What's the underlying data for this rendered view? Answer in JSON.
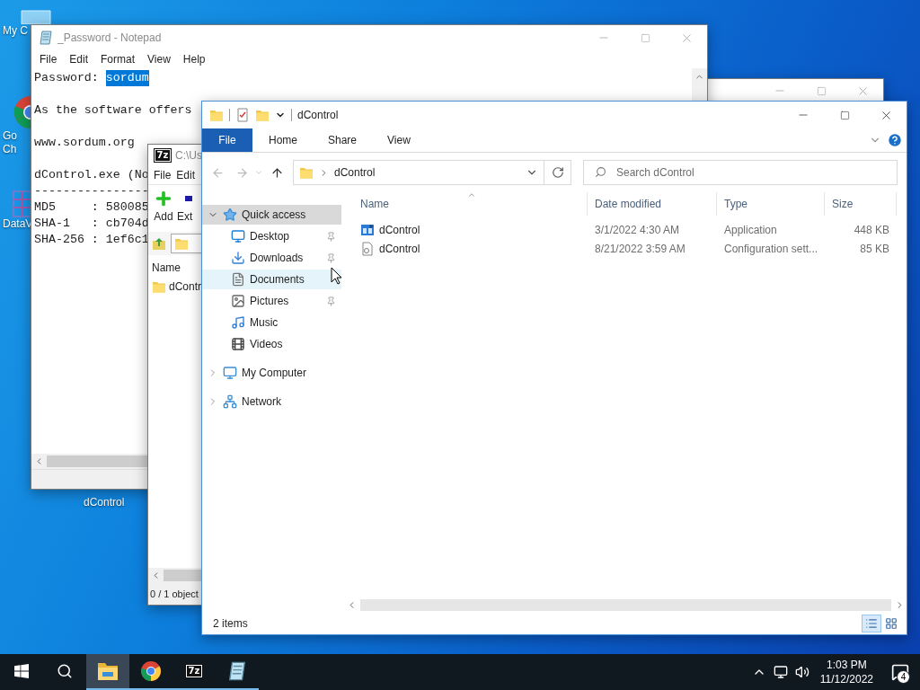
{
  "desktop": {
    "icons": [
      {
        "kind": "computer",
        "label_lines": [
          "My C"
        ]
      },
      {
        "kind": "chrome",
        "label_lines": [
          "Go",
          "Ch"
        ]
      },
      {
        "kind": "dataview",
        "label_lines": [
          "DataV"
        ]
      },
      {
        "kind": "app",
        "label_lines": [
          "dControl"
        ]
      }
    ]
  },
  "notepad": {
    "title": "_Password - Notepad",
    "menu": [
      "File",
      "Edit",
      "Format",
      "View",
      "Help"
    ],
    "paragraphs": [
      [
        {
          "text": "Password: ",
          "highlight": "sordum"
        }
      ],
      [
        {
          "text": "As the software offers"
        }
      ],
      [
        {
          "text": "www.sordum.org"
        }
      ],
      [
        {
          "text": "dControl.exe (No"
        },
        {
          "text": "----------------"
        },
        {
          "text": "MD5     : 580085"
        },
        {
          "text": "SHA-1   : cb704d"
        },
        {
          "text": "SHA-256 : 1ef6c1"
        }
      ]
    ]
  },
  "archiver": {
    "title": "C:\\Us",
    "icon_text": "7z",
    "menu": [
      "File",
      "Edit"
    ],
    "toolbar": [
      {
        "kind": "add",
        "label": "Add"
      },
      {
        "kind": "extract",
        "label": "Ext"
      }
    ],
    "column": "Name",
    "rows": [
      "dContr"
    ],
    "status": "0 / 1 object"
  },
  "explorer": {
    "title": "dControl",
    "tabs": [
      {
        "label": "File",
        "selected": true
      },
      {
        "label": "Home",
        "selected": false
      },
      {
        "label": "Share",
        "selected": false
      },
      {
        "label": "View",
        "selected": false
      }
    ],
    "address": "dControl",
    "search": {
      "placeholder": "Search dControl"
    },
    "nav": [
      {
        "label": "Quick access",
        "kind": "star",
        "expanded": true,
        "selected": true,
        "hovered": false,
        "children": [
          {
            "label": "Desktop",
            "kind": "desktop",
            "pinned": true,
            "selected": false,
            "hovered": false
          },
          {
            "label": "Downloads",
            "kind": "downloads",
            "pinned": true,
            "selected": false,
            "hovered": false
          },
          {
            "label": "Documents",
            "kind": "documents",
            "pinned": false,
            "selected": false,
            "hovered": true
          },
          {
            "label": "Pictures",
            "kind": "pictures",
            "pinned": true,
            "selected": false,
            "hovered": false
          },
          {
            "label": "Music",
            "kind": "music",
            "pinned": false,
            "selected": false,
            "hovered": false
          },
          {
            "label": "Videos",
            "kind": "videos",
            "pinned": false,
            "selected": false,
            "hovered": false
          }
        ]
      },
      {
        "label": "My Computer",
        "kind": "computer",
        "expanded": false,
        "selected": false,
        "hovered": false
      },
      {
        "label": "Network",
        "kind": "network",
        "expanded": false,
        "selected": false,
        "hovered": false
      }
    ],
    "columns": [
      "Name",
      "Date modified",
      "Type",
      "Size"
    ],
    "files": [
      {
        "kind": "application",
        "name": "dControl",
        "date": "3/1/2022 4:30 AM",
        "type": "Application",
        "size": "448 KB"
      },
      {
        "kind": "config",
        "name": "dControl",
        "date": "8/21/2022 3:59 AM",
        "type": "Configuration sett...",
        "size": "85 KB"
      }
    ],
    "status": "2 items",
    "views": [
      {
        "kind": "details",
        "selected": true
      },
      {
        "kind": "large_icons",
        "selected": false
      }
    ]
  },
  "taskbar": {
    "buttons": [
      {
        "kind": "start",
        "running": false,
        "active": false
      },
      {
        "kind": "search",
        "running": false,
        "active": false
      },
      {
        "kind": "explorer",
        "running": true,
        "active": true
      },
      {
        "kind": "chrome",
        "running": true,
        "active": false
      },
      {
        "kind": "archiver",
        "running": true,
        "active": false,
        "icon_text": "7z"
      },
      {
        "kind": "notepad",
        "running": true,
        "active": false
      }
    ],
    "tray": {
      "time": "1:03 PM",
      "date": "11/12/2022",
      "notifications": "4"
    }
  }
}
